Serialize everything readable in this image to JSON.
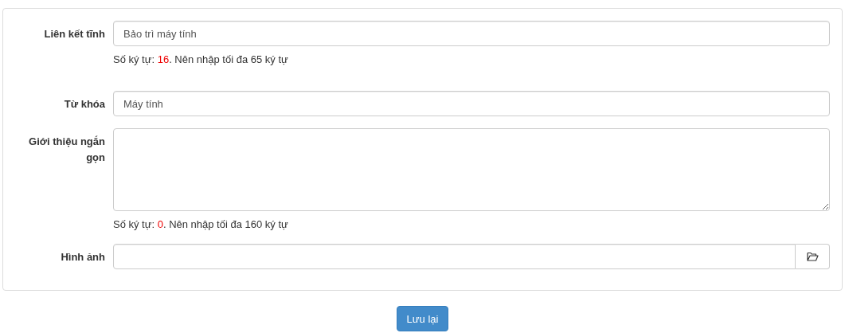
{
  "form": {
    "fields": [
      {
        "kind": "input",
        "label": "Liên kết tĩnh",
        "value": "Bảo trì máy tính",
        "counter": {
          "prefix": "Số ký tự: ",
          "count": "16",
          "suffix": ". Nên nhập tối đa 65 ký tự"
        }
      },
      {
        "kind": "input",
        "label": "Từ khóa",
        "value": "Máy tính"
      },
      {
        "kind": "textarea",
        "label": "Giới thiệu ngắn gọn",
        "counter": {
          "prefix": "Số ký tự: ",
          "count": "0",
          "suffix": ". Nên nhập tối đa 160 ký tự"
        }
      },
      {
        "kind": "file",
        "label": "Hình ảnh"
      }
    ]
  },
  "buttons": [
    {
      "label": "Lưu lại"
    }
  ]
}
